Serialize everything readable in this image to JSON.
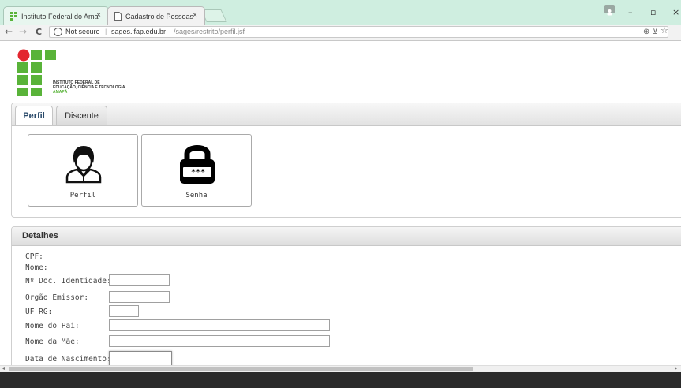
{
  "browser": {
    "tabs": [
      {
        "title": "Instituto Federal do Ama",
        "close": "×"
      },
      {
        "title": "Cadastro de Pessoas",
        "close": "×"
      }
    ],
    "window_controls": {
      "minimize": "–",
      "maximize": "▫",
      "close": "×"
    },
    "nav": {
      "back": "←",
      "forward": "→",
      "reload": "C"
    },
    "address": {
      "security_icon": "info-icon",
      "security_label": "Not secure",
      "separator": "|",
      "host": "sages.ifap.edu.br",
      "path": "/sages/restrito/perfil.jsf"
    }
  },
  "header": {
    "logo_lines": [
      "INSTITUTO FEDERAL DE",
      "EDUCAÇÃO, CIÊNCIA E TECNOLOGIA",
      "AMAPÁ"
    ],
    "colors": {
      "green": "#59b339",
      "red": "#e3262f"
    }
  },
  "tabs": [
    {
      "label": "Perfil",
      "active": true
    },
    {
      "label": "Discente",
      "active": false
    }
  ],
  "cards": [
    {
      "label": "Perfil",
      "icon": "user-profile-icon"
    },
    {
      "label": "Senha",
      "icon": "lock-password-icon",
      "code": "***"
    }
  ],
  "details": {
    "title": "Detalhes",
    "cpf_label": "CPF:",
    "nome_label": "Nome:",
    "fields": [
      {
        "label": "Nº Doc. Identidade:",
        "value": ""
      },
      {
        "label": "Órgão Emissor:",
        "value": ""
      },
      {
        "label": "UF RG:",
        "value": ""
      },
      {
        "label": "Nome do Pai:",
        "value": ""
      },
      {
        "label": "Nome da Mãe:",
        "value": ""
      },
      {
        "label": "Data de Nascimento:",
        "value": ""
      }
    ]
  }
}
